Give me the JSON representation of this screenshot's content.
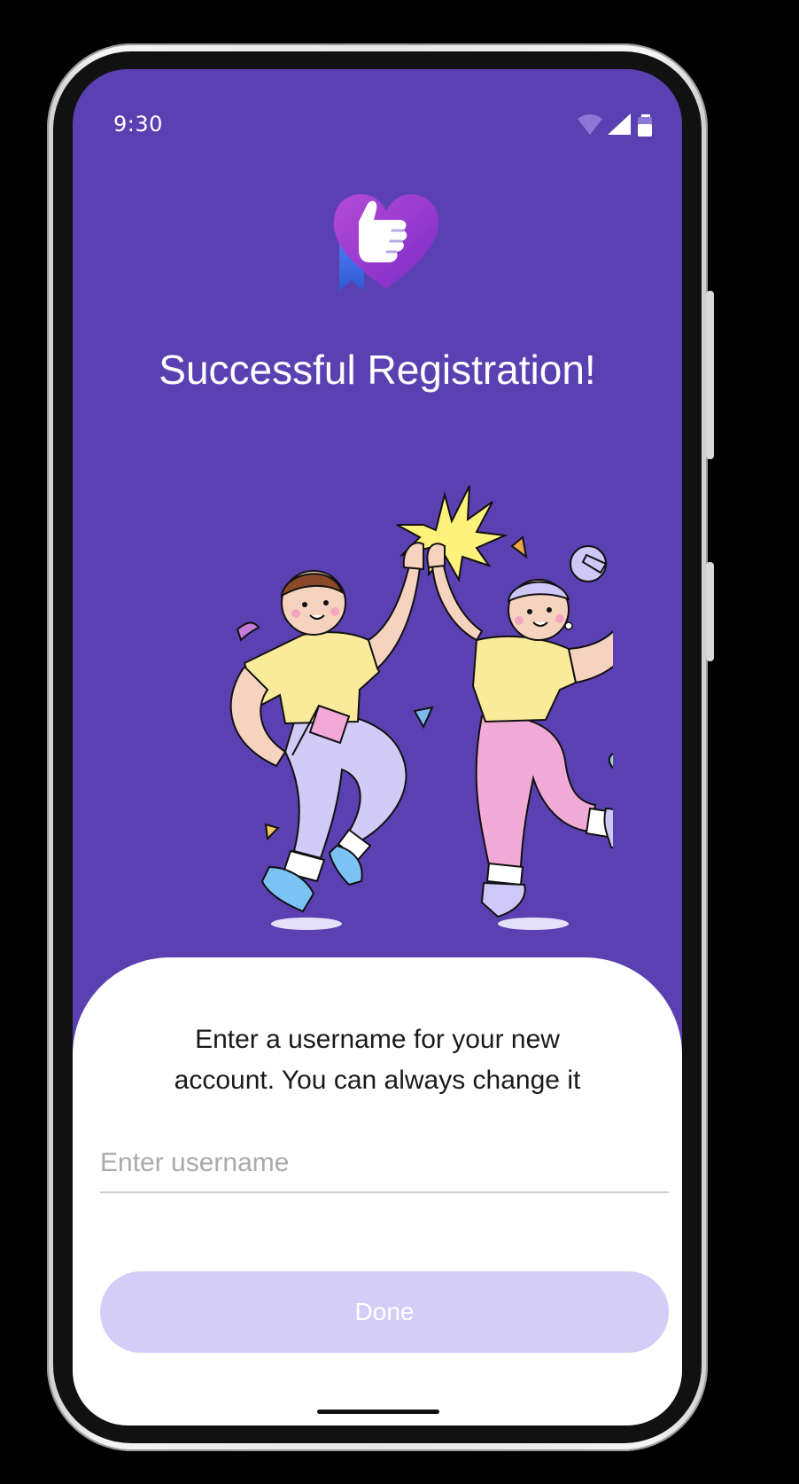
{
  "status_bar": {
    "time": "9:30"
  },
  "header": {
    "title": "Successful Registration!"
  },
  "form": {
    "instruction_line1": "Enter a username for your new",
    "instruction_line2": "account. You can always change it",
    "username_placeholder": "Enter username",
    "username_value": "",
    "done_label": "Done"
  },
  "icons": [
    "wifi-icon",
    "cellular-signal-icon",
    "battery-icon",
    "app-logo-heart-thumbs-up-icon"
  ],
  "colors": {
    "background": "#5b40b2",
    "button_disabled": "#d4cdf8",
    "sheet": "#ffffff"
  }
}
